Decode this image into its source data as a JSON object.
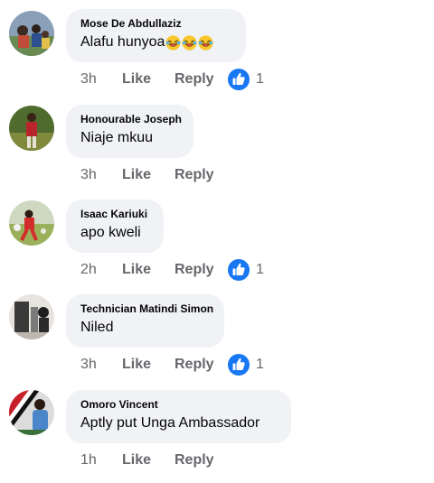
{
  "comments": [
    {
      "author": "Mose De Abdullaziz",
      "text": "Alafu hunyoa",
      "emoji": "laughing-emoji",
      "emoji_count": 3,
      "time": "3h",
      "like": "Like",
      "reply": "Reply",
      "reactions": "1"
    },
    {
      "author": "Honourable Joseph",
      "text": "Niaje mkuu",
      "time": "3h",
      "like": "Like",
      "reply": "Reply",
      "reactions": ""
    },
    {
      "author": "Isaac Kariuki",
      "text": "apo kweli",
      "time": "2h",
      "like": "Like",
      "reply": "Reply",
      "reactions": "1"
    },
    {
      "author": "Technician Matindi Simon",
      "text": "Niled",
      "time": "3h",
      "like": "Like",
      "reply": "Reply",
      "reactions": "1"
    },
    {
      "author": "Omoro Vincent",
      "text": "Aptly put Unga Ambassador",
      "time": "1h",
      "like": "Like",
      "reply": "Reply",
      "reactions": ""
    }
  ],
  "colors": {
    "like_blue": "#1877f2",
    "bubble": "#f0f2f5",
    "meta_text": "#65676b"
  }
}
